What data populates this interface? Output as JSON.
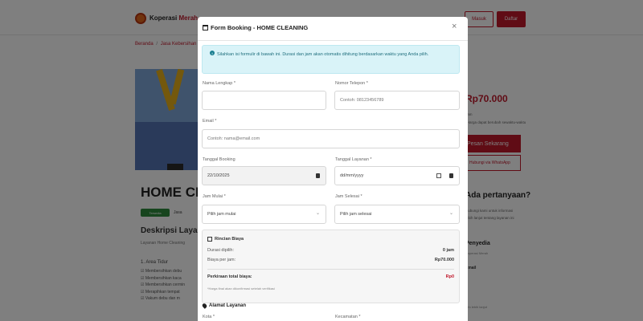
{
  "background": {
    "brand_name": "Koperasi ",
    "brand_accent": "Merah",
    "nav_masuk": "Masuk",
    "nav_daftar": "Daftar",
    "breadcrumb_home": "Beranda",
    "breadcrumb_sep": "/",
    "breadcrumb_current": "Jasa Kebersihan",
    "service_title": "HOME CLEANING",
    "badge_green": "Tersedia",
    "badge_grey": "Jasa",
    "description_title": "Deskripsi Layanan",
    "description_text": "Layanan Home Cleaning",
    "tasks_heading": "1. Area Tidur",
    "tasks": [
      "☑ Membersihkan debu",
      "☑ Membersihkan kaca",
      "☑ Membersihkan cermin",
      "☑ Merapihkan tempat",
      "☑ Vakum debu dan m"
    ],
    "price": "Rp70.000",
    "price_sub1": "/jam",
    "price_sub2": "*Harga dapat berubah sewaktu-waktu",
    "btn_pesan": "Pesan Sekarang",
    "btn_wa": "Hubungi via WhatsApp",
    "side_question": "Ada pertanyaan?",
    "side_text": [
      "Hubungi kami untuk informasi",
      "lebih lanjut tentang layanan ini"
    ],
    "side_provider": "Penyedia",
    "side_provider_sub": "Koperasi Merah",
    "side_email": "Email",
    "side_small": "Info lebih lanjut"
  },
  "modal": {
    "title": "Form Booking - HOME CLEANING",
    "close": "×",
    "alert_text": "Silahkan isi formulir di bawah ini. Durasi dan jam akan otomatis dihitung berdasarkan waktu yang Anda pilih.",
    "fields": {
      "nama_label": "Nama Lengkap *",
      "nama_value": "",
      "telepon_label": "Nomor Telepon *",
      "telepon_placeholder": "Contoh: 08123456789",
      "email_label": "Email *",
      "email_placeholder": "Contoh: nama@email.com",
      "tgl_booking_label": "Tanggal Booking",
      "tgl_booking_value": "22/10/2025",
      "tgl_layanan_label": "Tanggal Layanan *",
      "tgl_layanan_value": "dd/mm/yyyy",
      "jam_mulai_label": "Jam Mulai *",
      "jam_mulai_value": "Pilih jam mulai",
      "jam_selesai_label": "Jam Selesai *",
      "jam_selesai_value": "Pilih jam selesai"
    },
    "biaya": {
      "title": "Rincian Biaya",
      "durasi_label": "Durasi dipilih:",
      "durasi_value": "0 jam",
      "harga_label": "Biaya per jam:",
      "harga_value": "Rp70.000",
      "total_label": "Perkiraan total biaya:",
      "total_value": "Rp0",
      "note": "*Harga final akan dikonfirmasi setelah verifikasi"
    },
    "alamat_title": "Alamat Layanan",
    "kota_label": "Kota *",
    "kecamatan_label": "Kecamatan *"
  },
  "colors": {
    "brand": "#c0182b",
    "info_bg": "#d9f3f8",
    "info_text": "#1f6e7d"
  }
}
